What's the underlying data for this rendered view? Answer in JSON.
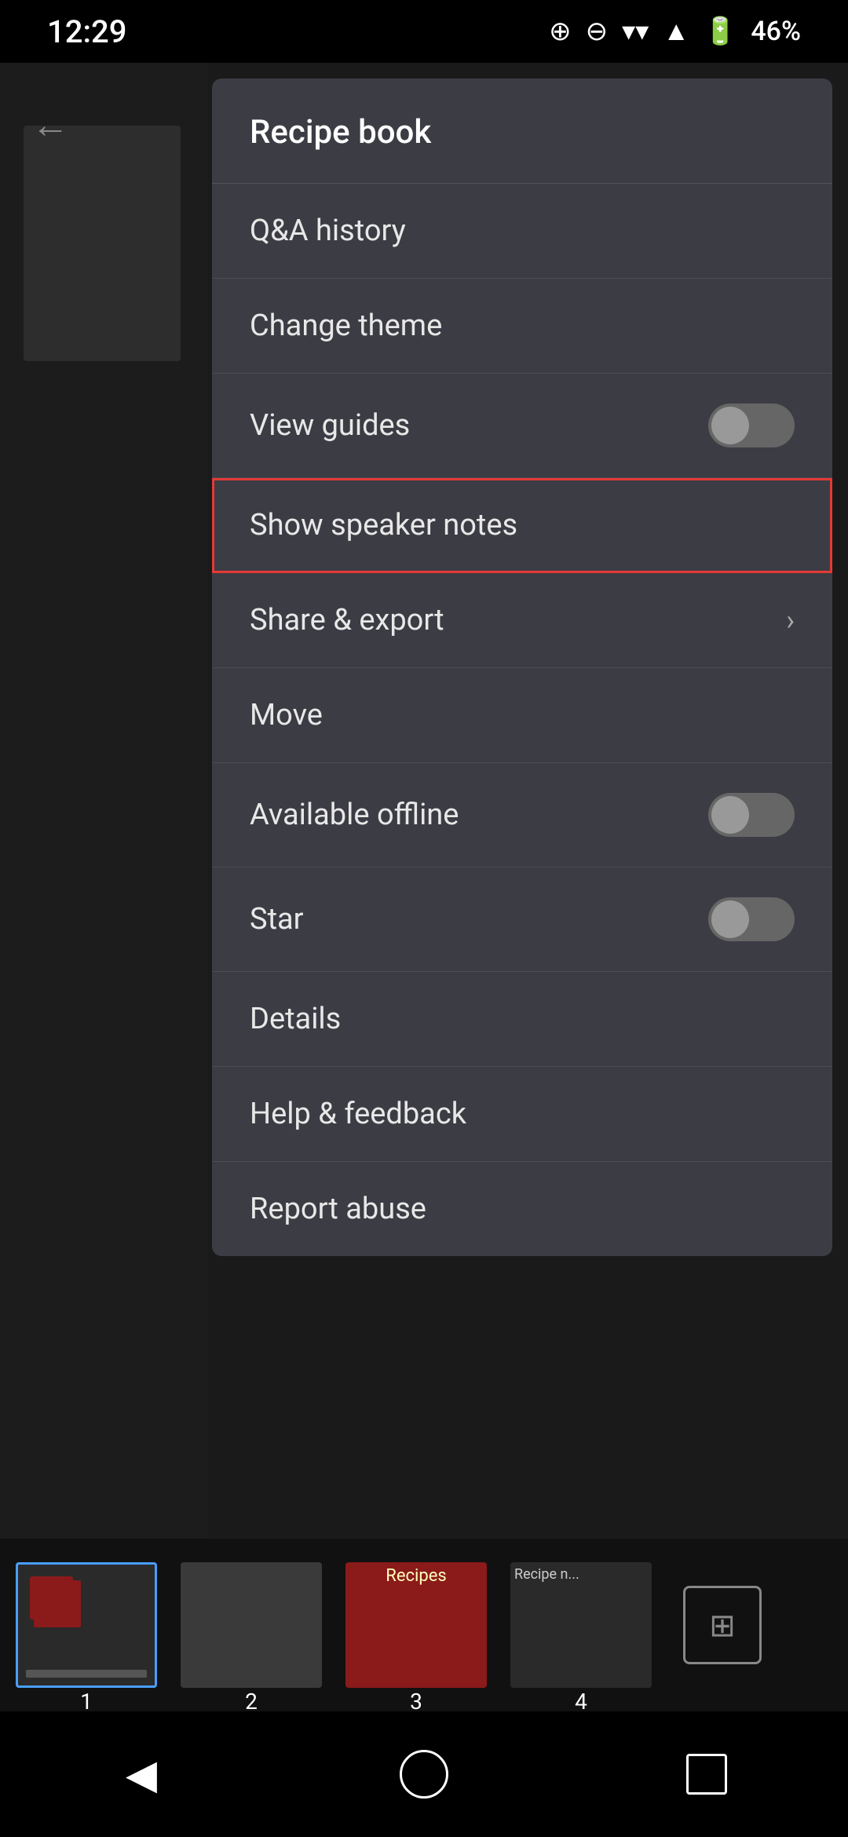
{
  "statusBar": {
    "time": "12:29",
    "battery": "46%"
  },
  "backButton": "←",
  "menu": {
    "title": "Recipe book",
    "items": [
      {
        "id": "qa-history",
        "label": "Q&A history",
        "type": "plain",
        "highlighted": false
      },
      {
        "id": "change-theme",
        "label": "Change theme",
        "type": "plain",
        "highlighted": false
      },
      {
        "id": "view-guides",
        "label": "View guides",
        "type": "toggle",
        "highlighted": false
      },
      {
        "id": "show-speaker-notes",
        "label": "Show speaker notes",
        "type": "plain",
        "highlighted": true
      },
      {
        "id": "share-export",
        "label": "Share & export",
        "type": "chevron",
        "highlighted": false
      },
      {
        "id": "move",
        "label": "Move",
        "type": "plain",
        "highlighted": false
      },
      {
        "id": "available-offline",
        "label": "Available offline",
        "type": "toggle",
        "highlighted": false
      },
      {
        "id": "star",
        "label": "Star",
        "type": "toggle",
        "highlighted": false
      },
      {
        "id": "details",
        "label": "Details",
        "type": "plain",
        "highlighted": false
      },
      {
        "id": "help-feedback",
        "label": "Help & feedback",
        "type": "plain",
        "highlighted": false
      },
      {
        "id": "report-abuse",
        "label": "Report abuse",
        "type": "plain",
        "highlighted": false
      }
    ]
  },
  "thumbnails": [
    {
      "num": "1",
      "active": true
    },
    {
      "num": "2",
      "active": false
    },
    {
      "num": "3",
      "active": false
    },
    {
      "num": "4",
      "active": false
    }
  ],
  "navBar": {
    "back": "◀",
    "home": "○",
    "recent": "□"
  }
}
